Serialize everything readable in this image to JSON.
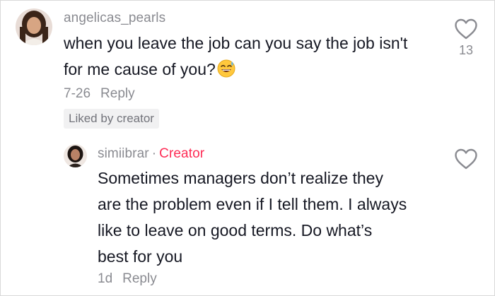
{
  "comment": {
    "username": "angelicas_pearls",
    "text": "when you leave the job can you say the job isn't for me cause of you?",
    "emoji": "sweat-smile-emoji",
    "date": "7-26",
    "reply_label": "Reply",
    "like_count": "13",
    "liked_badge": "Liked by creator"
  },
  "reply": {
    "username": "simiibrar",
    "separator": "·",
    "creator_label": "Creator",
    "text_lines": [
      "Sometimes managers don’t realize they",
      "are the problem even if I tell them. I always",
      "like to leave on good terms. Do what’s",
      "best for you"
    ],
    "date": "1d",
    "reply_label": "Reply"
  },
  "colors": {
    "creator_accent": "#fe2c55",
    "muted_text": "#8a8b91",
    "primary_text": "#161823"
  }
}
